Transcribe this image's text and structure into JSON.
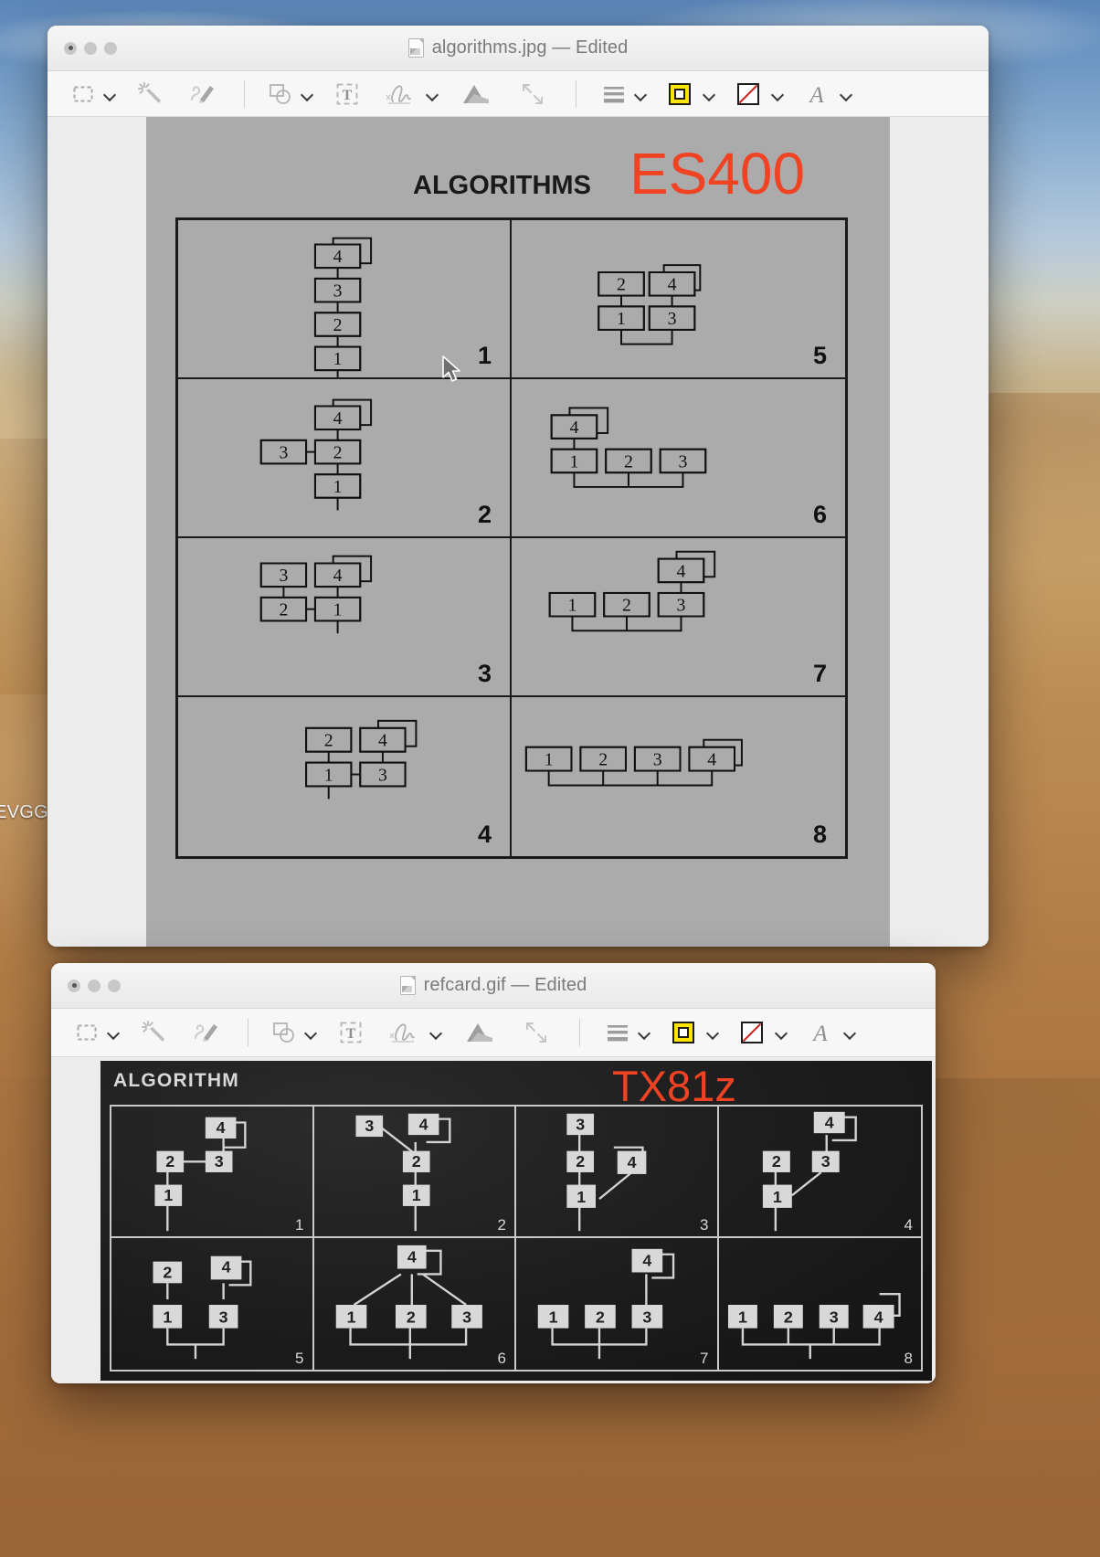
{
  "desktop": {
    "partial_icon_label": "EVGG"
  },
  "windows": [
    {
      "id": "algorithms-window",
      "title": "algorithms.jpg — Edited",
      "traffic_lights": [
        "close",
        "minimize",
        "zoom"
      ],
      "toolbar": {
        "items": [
          {
            "name": "rectangular-selection-icon",
            "label": "Rectangular Selection",
            "dropdown": true
          },
          {
            "name": "instant-alpha-icon",
            "label": "Instant Alpha",
            "dropdown": false
          },
          {
            "name": "markup-icon",
            "label": "Show Markup Toolbar",
            "dropdown": false
          },
          {
            "name": "shapes-icon",
            "label": "Shapes",
            "dropdown": true
          },
          {
            "name": "text-icon",
            "label": "Text",
            "dropdown": false
          },
          {
            "name": "sign-icon",
            "label": "Sign",
            "dropdown": true
          },
          {
            "name": "adjust-color-icon",
            "label": "Adjust Color",
            "dropdown": false
          },
          {
            "name": "crop-icon",
            "label": "Crop",
            "dropdown": false
          },
          {
            "name": "shape-style-icon",
            "label": "Shape Style",
            "dropdown": true
          },
          {
            "name": "border-color-icon",
            "label": "Border Color",
            "dropdown": true
          },
          {
            "name": "fill-color-icon",
            "label": "Fill Color",
            "dropdown": true
          },
          {
            "name": "text-style-icon",
            "label": "Text Style",
            "dropdown": true
          }
        ]
      },
      "image": {
        "heading": "ALGORITHMS",
        "model": "ES400",
        "cells": [
          "1",
          "2",
          "3",
          "4",
          "5",
          "6",
          "7",
          "8"
        ]
      }
    },
    {
      "id": "refcard-window",
      "title": "refcard.gif — Edited",
      "traffic_lights": [
        "close",
        "minimize",
        "zoom"
      ],
      "toolbar": {
        "items": [
          {
            "name": "rectangular-selection-icon",
            "label": "Rectangular Selection",
            "dropdown": true
          },
          {
            "name": "instant-alpha-icon",
            "label": "Instant Alpha",
            "dropdown": false
          },
          {
            "name": "markup-icon",
            "label": "Show Markup Toolbar",
            "dropdown": false
          },
          {
            "name": "shapes-icon",
            "label": "Shapes",
            "dropdown": true
          },
          {
            "name": "text-icon",
            "label": "Text",
            "dropdown": false
          },
          {
            "name": "sign-icon",
            "label": "Sign",
            "dropdown": true
          },
          {
            "name": "adjust-color-icon",
            "label": "Adjust Color",
            "dropdown": false
          },
          {
            "name": "crop-icon",
            "label": "Crop",
            "dropdown": false
          },
          {
            "name": "shape-style-icon",
            "label": "Shape Style",
            "dropdown": true
          },
          {
            "name": "border-color-icon",
            "label": "Border Color",
            "dropdown": true
          },
          {
            "name": "fill-color-icon",
            "label": "Fill Color",
            "dropdown": true
          },
          {
            "name": "text-style-icon",
            "label": "Text Style",
            "dropdown": true
          }
        ]
      },
      "image": {
        "heading": "ALGORITHM",
        "model": "TX81z",
        "cells": [
          "1",
          "2",
          "3",
          "4",
          "5",
          "6",
          "7",
          "8"
        ]
      }
    }
  ],
  "colors": {
    "annotation_red": "#ef4323",
    "border_color_swatch": "#ffe500",
    "fill_slash": "#cc2222",
    "image_background": "#ababab",
    "refcard_background": "#1b1b1b"
  },
  "algorithm_operators": {
    "es400": [
      {
        "cell": "1",
        "operators": [
          "4",
          "3",
          "2",
          "1"
        ]
      },
      {
        "cell": "2",
        "operators": [
          "4",
          "3",
          "2",
          "1"
        ]
      },
      {
        "cell": "3",
        "operators": [
          "3",
          "4",
          "2",
          "1"
        ]
      },
      {
        "cell": "4",
        "operators": [
          "2",
          "4",
          "1",
          "3"
        ]
      },
      {
        "cell": "5",
        "operators": [
          "2",
          "4",
          "1",
          "3"
        ]
      },
      {
        "cell": "6",
        "operators": [
          "4",
          "1",
          "2",
          "3"
        ]
      },
      {
        "cell": "7",
        "operators": [
          "4",
          "1",
          "2",
          "3"
        ]
      },
      {
        "cell": "8",
        "operators": [
          "1",
          "2",
          "3",
          "4"
        ]
      }
    ],
    "tx81z": [
      {
        "cell": "1",
        "operators": [
          "4",
          "2",
          "3",
          "1"
        ]
      },
      {
        "cell": "2",
        "operators": [
          "3",
          "4",
          "2",
          "1"
        ]
      },
      {
        "cell": "3",
        "operators": [
          "3",
          "2",
          "4",
          "1"
        ]
      },
      {
        "cell": "4",
        "operators": [
          "4",
          "2",
          "3",
          "1"
        ]
      },
      {
        "cell": "5",
        "operators": [
          "2",
          "4",
          "1",
          "3"
        ]
      },
      {
        "cell": "6",
        "operators": [
          "4",
          "1",
          "2",
          "3"
        ]
      },
      {
        "cell": "7",
        "operators": [
          "4",
          "1",
          "2",
          "3"
        ]
      },
      {
        "cell": "8",
        "operators": [
          "1",
          "2",
          "3",
          "4"
        ]
      }
    ]
  }
}
